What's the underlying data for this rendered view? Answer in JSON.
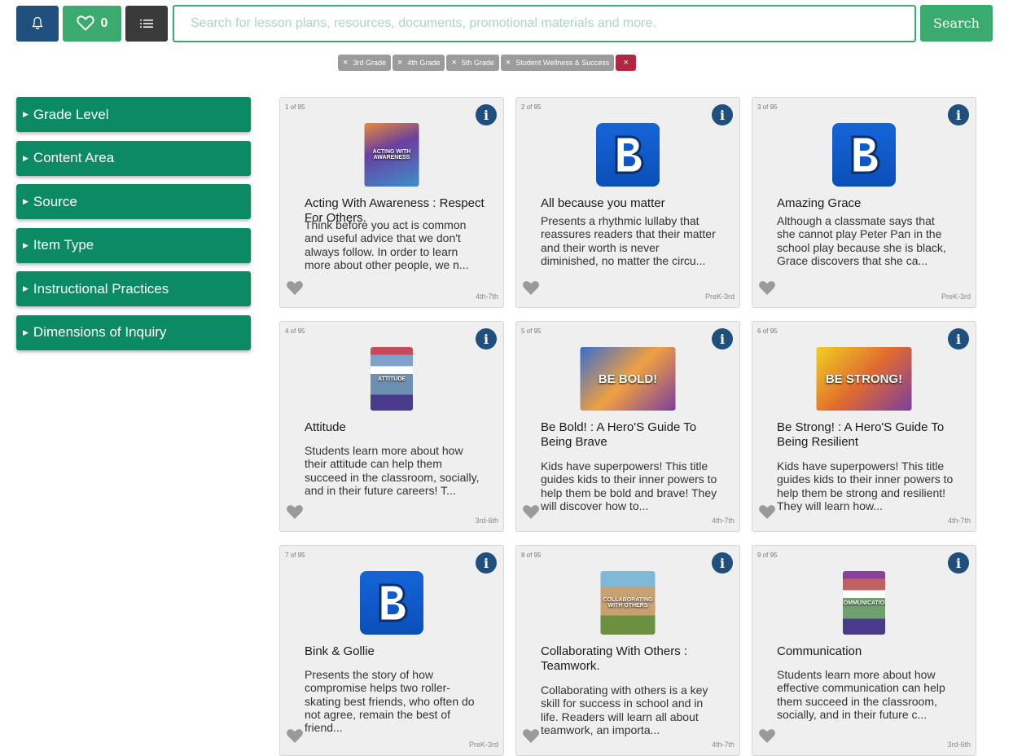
{
  "topbar": {
    "favorites_count": "0",
    "search_placeholder": "Search for lesson plans, resources, documents, promotional materials and more.",
    "search_button": "Search"
  },
  "filters": [
    {
      "label": "3rd Grade"
    },
    {
      "label": "4th Grade"
    },
    {
      "label": "5th Grade"
    },
    {
      "label": "Student Wellness & Success"
    }
  ],
  "sidebar": {
    "items": [
      {
        "label": "Grade Level"
      },
      {
        "label": "Content Area"
      },
      {
        "label": "Source"
      },
      {
        "label": "Item Type"
      },
      {
        "label": "Instructional Practices"
      },
      {
        "label": "Dimensions of Inquiry"
      }
    ]
  },
  "colors": {
    "primary_green": "#3aaa6f",
    "facet_green": "#0c8a63",
    "navy": "#1e4f7d",
    "clear_red": "#b3263f"
  },
  "cards": [
    {
      "count": "1 of 95",
      "title": "Acting With Awareness : Respect For Others.",
      "description": "Think before you act is common and useful advice that we don't always follow. In order to learn more about other people, we n...",
      "grade": "4th-7th",
      "thumb": "book",
      "thumb_text": "ACTING WITH AWARENESS"
    },
    {
      "count": "2 of 95",
      "title": "All because you matter",
      "description": "Presents a rhythmic lullaby that reassures readers that their matter and their worth is never diminished, no matter the circu...",
      "grade": "PreK-3rd",
      "thumb": "b-logo"
    },
    {
      "count": "3 of 95",
      "title": "Amazing Grace",
      "description": "Although a classmate says that she cannot play Peter Pan in the school play because she is black, Grace discovers that she ca...",
      "grade": "PreK-3rd",
      "thumb": "b-logo"
    },
    {
      "count": "4 of 95",
      "title": "Attitude",
      "description": "Students learn more about how their attitude can help them succeed in the classroom, socially, and in their future careers! T...",
      "grade": "3rd-6th",
      "thumb": "book",
      "thumb_text": "ATTITUDE"
    },
    {
      "count": "5 of 95",
      "title": "Be Bold! : A Hero'S Guide To Being Brave",
      "description": "Kids have superpowers! This title guides kids to their inner powers to help them be bold and brave! They will discover how to...",
      "grade": "4th-7th",
      "thumb": "wide",
      "thumb_text": "BE BOLD!"
    },
    {
      "count": "6 of 95",
      "title": "Be Strong! : A Hero'S Guide To Being Resilient",
      "description": "Kids have superpowers! This title guides kids to their inner powers to help them be strong and resilient! They will learn how...",
      "grade": "4th-7th",
      "thumb": "wide",
      "thumb_text": "BE STRONG!"
    },
    {
      "count": "7 of 95",
      "title": "Bink & Gollie",
      "description": "Presents the story of how compromise helps two roller-skating best friends, who often do not agree, remain the best of friend...",
      "grade": "PreK-3rd",
      "thumb": "b-logo"
    },
    {
      "count": "8 of 95",
      "title": "Collaborating With Others : Teamwork.",
      "description": "Collaborating with others is a key skill for success in school and in life. Readers will learn all about teamwork, an importa...",
      "grade": "4th-7th",
      "thumb": "book",
      "thumb_text": "COLLABORATING WITH OTHERS"
    },
    {
      "count": "9 of 95",
      "title": "Communication",
      "description": "Students learn more about how effective communication can help them succeed in the classroom, socially, and in their future c...",
      "grade": "3rd-6th",
      "thumb": "book",
      "thumb_text": "COMMUNICATION"
    }
  ]
}
